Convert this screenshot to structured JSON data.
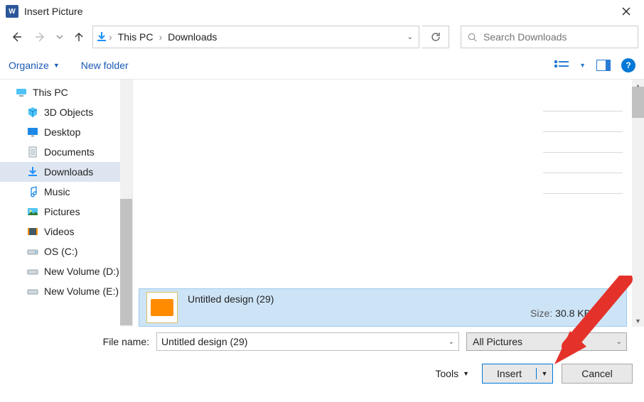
{
  "title": "Insert Picture",
  "breadcrumbs": {
    "pc": "This PC",
    "folder": "Downloads"
  },
  "search": {
    "placeholder": "Search Downloads"
  },
  "toolbar": {
    "organize": "Organize",
    "newfolder": "New folder"
  },
  "tree": {
    "root": "This PC",
    "items": [
      {
        "label": "3D Objects"
      },
      {
        "label": "Desktop"
      },
      {
        "label": "Documents"
      },
      {
        "label": "Downloads",
        "selected": true
      },
      {
        "label": "Music"
      },
      {
        "label": "Pictures"
      },
      {
        "label": "Videos"
      },
      {
        "label": "OS (C:)"
      },
      {
        "label": "New Volume (D:)"
      },
      {
        "label": "New Volume (E:)"
      }
    ]
  },
  "file": {
    "name": "Untitled design (29)",
    "size_label": "Size:",
    "size_value": "30.8 KB"
  },
  "footer": {
    "filename_label": "File name:",
    "filename_value": "Untitled design (29)",
    "filter": "All Pictures",
    "tools": "Tools",
    "insert": "Insert",
    "cancel": "Cancel"
  }
}
